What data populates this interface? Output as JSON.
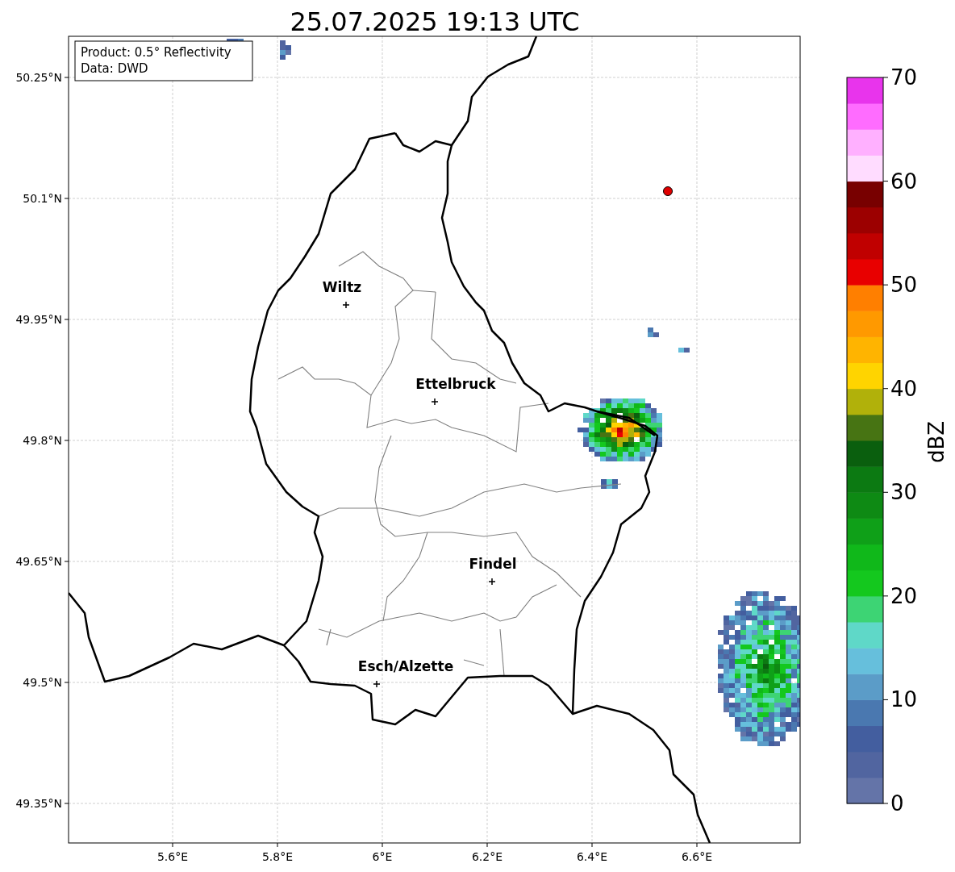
{
  "title": "25.07.2025 19:13 UTC",
  "legend": [
    "Product: 0.5° Reflectivity",
    "Data: DWD"
  ],
  "xticks": [
    "5.6°E",
    "5.8°E",
    "6°E",
    "6.2°E",
    "6.4°E",
    "6.6°E"
  ],
  "yticks": [
    "50.25°N",
    "50.1°N",
    "49.95°N",
    "49.8°N",
    "49.65°N",
    "49.5°N",
    "49.35°N"
  ],
  "cities": [
    {
      "name": "Wiltz"
    },
    {
      "name": "Ettelbruck"
    },
    {
      "name": "Findel"
    },
    {
      "name": "Esch/Alzette"
    }
  ],
  "colorbar": {
    "label": "dBZ",
    "ticks": [
      "70",
      "60",
      "50",
      "40",
      "30",
      "20",
      "10",
      "0"
    ],
    "bins": [
      {
        "color": "#6474a8"
      },
      {
        "color": "#5165a0"
      },
      {
        "color": "#435e9f"
      },
      {
        "color": "#4a78b0"
      },
      {
        "color": "#5b9cc8"
      },
      {
        "color": "#66bfdc"
      },
      {
        "color": "#5fd8c8"
      },
      {
        "color": "#3dd474"
      },
      {
        "color": "#14c81e"
      },
      {
        "color": "#10b81a"
      },
      {
        "color": "#0fa018"
      },
      {
        "color": "#0e8a14"
      },
      {
        "color": "#0c7a12"
      },
      {
        "color": "#0a5f0e"
      },
      {
        "color": "#477413"
      },
      {
        "color": "#b1b10a"
      },
      {
        "color": "#ffd400"
      },
      {
        "color": "#ffb400"
      },
      {
        "color": "#ff9900"
      },
      {
        "color": "#ff7f00"
      },
      {
        "color": "#e80000"
      },
      {
        "color": "#c00000"
      },
      {
        "color": "#9c0000"
      },
      {
        "color": "#780000"
      },
      {
        "color": "#ffdcff"
      },
      {
        "color": "#ffb0ff"
      },
      {
        "color": "#ff6cff"
      },
      {
        "color": "#e834ec"
      }
    ]
  }
}
